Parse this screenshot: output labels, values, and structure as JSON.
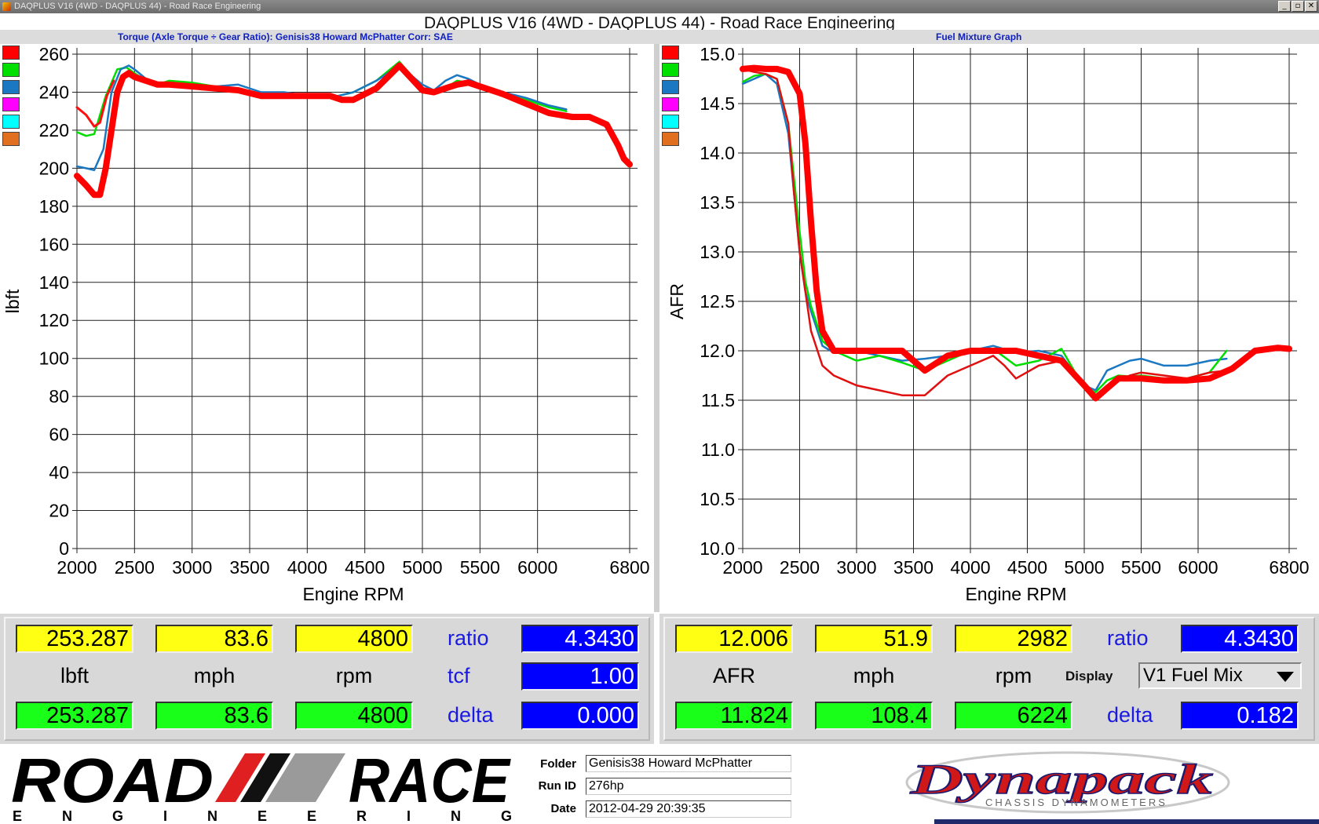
{
  "window": {
    "titlebar_text": "DAQPLUS V16 (4WD - DAQPLUS 44) - Road Race Engineering",
    "main_title": "DAQPLUS V16 (4WD - DAQPLUS 44) - Road Race Engineering",
    "minimize": "_",
    "restore": "▫",
    "close": "✕"
  },
  "left_graph": {
    "header": "Torque (Axle Torque ÷ Gear Ratio): Genisis38 Howard McPhatter       Corr: SAE",
    "readout": {
      "cursor_value": "253.287",
      "cursor_mph": "83.6",
      "cursor_rpm": "4800",
      "unit_main": "lbft",
      "unit_mph": "mph",
      "unit_rpm": "rpm",
      "ref_value": "253.287",
      "ref_mph": "83.6",
      "ref_rpm": "4800",
      "ratio_label": "ratio",
      "ratio_value": "4.3430",
      "tcf_label": "tcf",
      "tcf_value": "1.00",
      "delta_label": "delta",
      "delta_value": "0.000"
    }
  },
  "right_graph": {
    "header": "Fuel Mixture Graph",
    "readout": {
      "cursor_value": "12.006",
      "cursor_mph": "51.9",
      "cursor_rpm": "2982",
      "unit_main": "AFR",
      "unit_mph": "mph",
      "unit_rpm": "rpm",
      "ref_value": "11.824",
      "ref_mph": "108.4",
      "ref_rpm": "6224",
      "ratio_label": "ratio",
      "ratio_value": "4.3430",
      "display_label": "Display",
      "display_select": "V1 Fuel Mix",
      "delta_label": "delta",
      "delta_value": "0.182"
    }
  },
  "swatch_colors": [
    "#ff0000",
    "#00e000",
    "#1a78c2",
    "#ff00ff",
    "#00ffff",
    "#e07020"
  ],
  "footer": {
    "logo_top": "ROAD",
    "logo_top2": "RACE",
    "logo_sub": "E N G I N E E R I N G",
    "folder_label": "Folder",
    "folder_value": "Genisis38 Howard McPhatter",
    "runid_label": "Run ID",
    "runid_value": "276hp",
    "date_label": "Date",
    "date_value": "2012-04-29 20:39:35",
    "brand": "Dynapack",
    "brand_sub": "CHASSIS DYNAMOMETERS"
  },
  "chart_data": [
    {
      "type": "line",
      "title": "Torque (Axle Torque ÷ Gear Ratio): Genisis38 Howard McPhatter",
      "xlabel": "Engine RPM",
      "ylabel": "lbft",
      "xlim": [
        2000,
        6800
      ],
      "ylim": [
        0,
        260
      ],
      "x_ticks": [
        2000,
        2500,
        3000,
        3500,
        4000,
        4500,
        5000,
        5500,
        6000,
        6800
      ],
      "y_ticks": [
        0,
        20,
        40,
        60,
        80,
        100,
        120,
        140,
        160,
        180,
        200,
        220,
        240,
        260
      ],
      "grid": true,
      "series": [
        {
          "color": "#00dd00",
          "width": 2.5,
          "x": [
            2000,
            2080,
            2150,
            2250,
            2350,
            2430,
            2500,
            2600,
            2700,
            2800,
            3000,
            3200,
            3400,
            3600,
            3800,
            4000,
            4200,
            4400,
            4600,
            4800,
            5000,
            5100,
            5200,
            5300,
            5400,
            5500,
            5700,
            5900,
            6100,
            6250
          ],
          "y": [
            219,
            217,
            218,
            238,
            252,
            253,
            250,
            246,
            244,
            246,
            245,
            243,
            241,
            239,
            238,
            238,
            237,
            240,
            246,
            256,
            242,
            240,
            242,
            246,
            245,
            243,
            239,
            236,
            232,
            230
          ]
        },
        {
          "color": "#1a78c2",
          "width": 2.5,
          "x": [
            2000,
            2080,
            2150,
            2230,
            2300,
            2380,
            2450,
            2500,
            2600,
            2700,
            2800,
            3000,
            3200,
            3400,
            3600,
            3800,
            4000,
            4200,
            4400,
            4600,
            4800,
            5000,
            5100,
            5200,
            5300,
            5400,
            5500,
            5700,
            5900,
            6100,
            6250
          ],
          "y": [
            201,
            200,
            199,
            210,
            240,
            252,
            254,
            252,
            247,
            245,
            244,
            244,
            243,
            244,
            240,
            240,
            238,
            237,
            240,
            246,
            254,
            244,
            241,
            246,
            249,
            247,
            244,
            240,
            237,
            233,
            231
          ]
        },
        {
          "color": "#ff1010",
          "width": 3,
          "x": [
            2000,
            2080,
            2150,
            2200,
            2260,
            2320
          ],
          "y": [
            232,
            228,
            222,
            224,
            238,
            246
          ]
        },
        {
          "color": "#ff0000",
          "width": 8,
          "x": [
            2000,
            2080,
            2150,
            2200,
            2250,
            2300,
            2350,
            2400,
            2450,
            2500,
            2600,
            2700,
            2800,
            3000,
            3200,
            3400,
            3600,
            3800,
            4000,
            4200,
            4300,
            4400,
            4600,
            4800,
            5000,
            5100,
            5200,
            5300,
            5400,
            5500,
            5700,
            5900,
            6100,
            6300,
            6450,
            6600,
            6700,
            6750,
            6800
          ],
          "y": [
            196,
            191,
            186,
            186,
            200,
            220,
            240,
            248,
            250,
            248,
            246,
            244,
            244,
            243,
            242,
            241,
            238,
            238,
            238,
            238,
            236,
            236,
            242,
            254,
            241,
            240,
            242,
            244,
            245,
            243,
            239,
            234,
            229,
            227,
            227,
            223,
            212,
            205,
            202
          ]
        }
      ]
    },
    {
      "type": "line",
      "title": "Fuel Mixture Graph",
      "xlabel": "Engine RPM",
      "ylabel": "AFR",
      "xlim": [
        2000,
        6800
      ],
      "ylim": [
        10.0,
        15.0
      ],
      "x_ticks": [
        2000,
        2500,
        3000,
        3500,
        4000,
        4500,
        5000,
        5500,
        6000,
        6800
      ],
      "y_ticks": [
        10.0,
        10.5,
        11.0,
        11.5,
        12.0,
        12.5,
        13.0,
        13.5,
        14.0,
        14.5,
        15.0
      ],
      "grid": true,
      "series": [
        {
          "color": "#1a78c2",
          "width": 2.5,
          "x": [
            2000,
            2100,
            2200,
            2300,
            2400,
            2500,
            2550,
            2600,
            2700,
            2800,
            3000,
            3200,
            3400,
            3600,
            3800,
            4000,
            4200,
            4400,
            4600,
            4800,
            5000,
            5100,
            5200,
            5300,
            5400,
            5500,
            5700,
            5900,
            6100,
            6250
          ],
          "y": [
            14.7,
            14.75,
            14.8,
            14.7,
            14.2,
            13.0,
            12.6,
            12.4,
            12.05,
            11.98,
            12.0,
            11.95,
            11.9,
            11.92,
            11.95,
            12.0,
            12.05,
            11.98,
            12.0,
            11.95,
            11.65,
            11.6,
            11.8,
            11.85,
            11.9,
            11.92,
            11.85,
            11.85,
            11.9,
            11.92
          ]
        },
        {
          "color": "#00dd00",
          "width": 2.5,
          "x": [
            2000,
            2100,
            2200,
            2300,
            2400,
            2500,
            2550,
            2600,
            2700,
            2800,
            3000,
            3200,
            3400,
            3600,
            3800,
            4000,
            4200,
            4400,
            4600,
            4800,
            5000,
            5100,
            5200,
            5300,
            5400,
            5500,
            5700,
            5900,
            6100,
            6250
          ],
          "y": [
            14.72,
            14.78,
            14.8,
            14.75,
            14.3,
            13.2,
            12.7,
            12.45,
            12.1,
            12.0,
            11.9,
            11.95,
            11.88,
            11.8,
            11.9,
            12.0,
            12.02,
            11.85,
            11.9,
            12.02,
            11.62,
            11.58,
            11.7,
            11.75,
            11.74,
            11.75,
            11.72,
            11.72,
            11.78,
            12.0
          ]
        },
        {
          "color": "#e01010",
          "width": 2.5,
          "x": [
            2000,
            2100,
            2200,
            2300,
            2400,
            2450,
            2500,
            2600,
            2700,
            2800,
            2900,
            3000,
            3200,
            3400,
            3600,
            3800,
            4000,
            4200,
            4300,
            4400,
            4600,
            4800,
            5000,
            5100,
            5200,
            5300,
            5400,
            5500,
            5700,
            5900,
            6100,
            6250
          ],
          "y": [
            14.85,
            14.82,
            14.8,
            14.75,
            14.3,
            13.6,
            13.0,
            12.2,
            11.85,
            11.75,
            11.7,
            11.65,
            11.6,
            11.55,
            11.55,
            11.75,
            11.85,
            11.95,
            11.85,
            11.72,
            11.85,
            11.9,
            11.62,
            11.55,
            11.65,
            11.7,
            11.75,
            11.78,
            11.75,
            11.72,
            11.78,
            11.8
          ]
        },
        {
          "color": "#ff0000",
          "width": 8,
          "x": [
            2000,
            2100,
            2200,
            2300,
            2400,
            2500,
            2550,
            2600,
            2650,
            2700,
            2800,
            2900,
            3000,
            3200,
            3400,
            3600,
            3800,
            4000,
            4200,
            4400,
            4600,
            4800,
            5000,
            5100,
            5200,
            5300,
            5400,
            5500,
            5700,
            5900,
            6100,
            6300,
            6500,
            6700,
            6800
          ],
          "y": [
            14.85,
            14.86,
            14.85,
            14.85,
            14.82,
            14.6,
            14.1,
            13.3,
            12.6,
            12.2,
            12.0,
            12.0,
            12.0,
            12.0,
            12.0,
            11.8,
            11.95,
            12.0,
            12.0,
            12.0,
            11.95,
            11.9,
            11.65,
            11.52,
            11.62,
            11.72,
            11.72,
            11.72,
            11.7,
            11.7,
            11.72,
            11.82,
            12.0,
            12.03,
            12.02
          ]
        }
      ]
    }
  ]
}
